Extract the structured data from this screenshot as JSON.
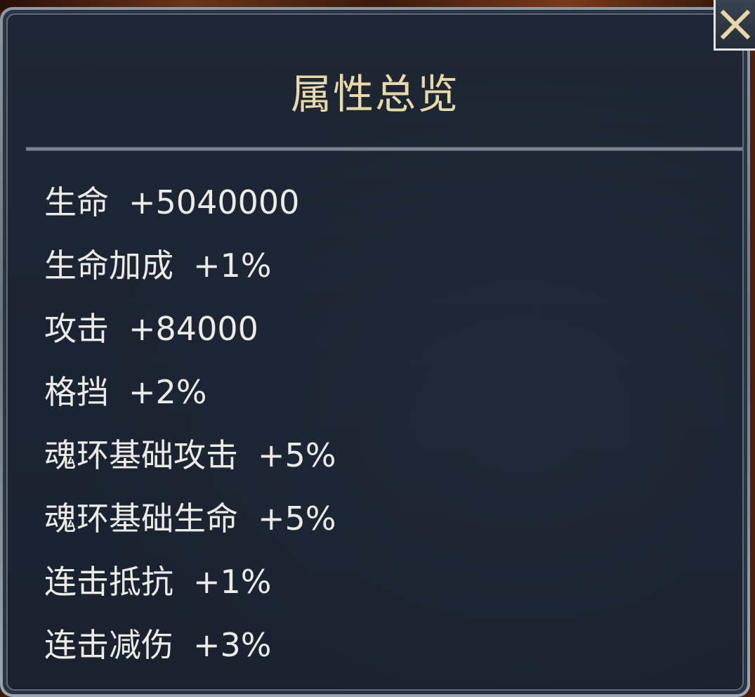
{
  "panel": {
    "title": "属性总览"
  },
  "stats": [
    {
      "label": "生命",
      "value": "+5040000"
    },
    {
      "label": "生命加成",
      "value": "+1%"
    },
    {
      "label": "攻击",
      "value": "+84000"
    },
    {
      "label": "格挡",
      "value": "+2%"
    },
    {
      "label": "魂环基础攻击",
      "value": "+5%"
    },
    {
      "label": "魂环基础生命",
      "value": "+5%"
    },
    {
      "label": "连击抵抗",
      "value": "+1%"
    },
    {
      "label": "连击减伤",
      "value": "+3%"
    }
  ],
  "close_button": {
    "icon": "close-icon"
  },
  "colors": {
    "title": "#e9d9a8",
    "text": "#ecebe6",
    "panel_bg": "#1e2735",
    "frame": "#8d9aa6"
  }
}
